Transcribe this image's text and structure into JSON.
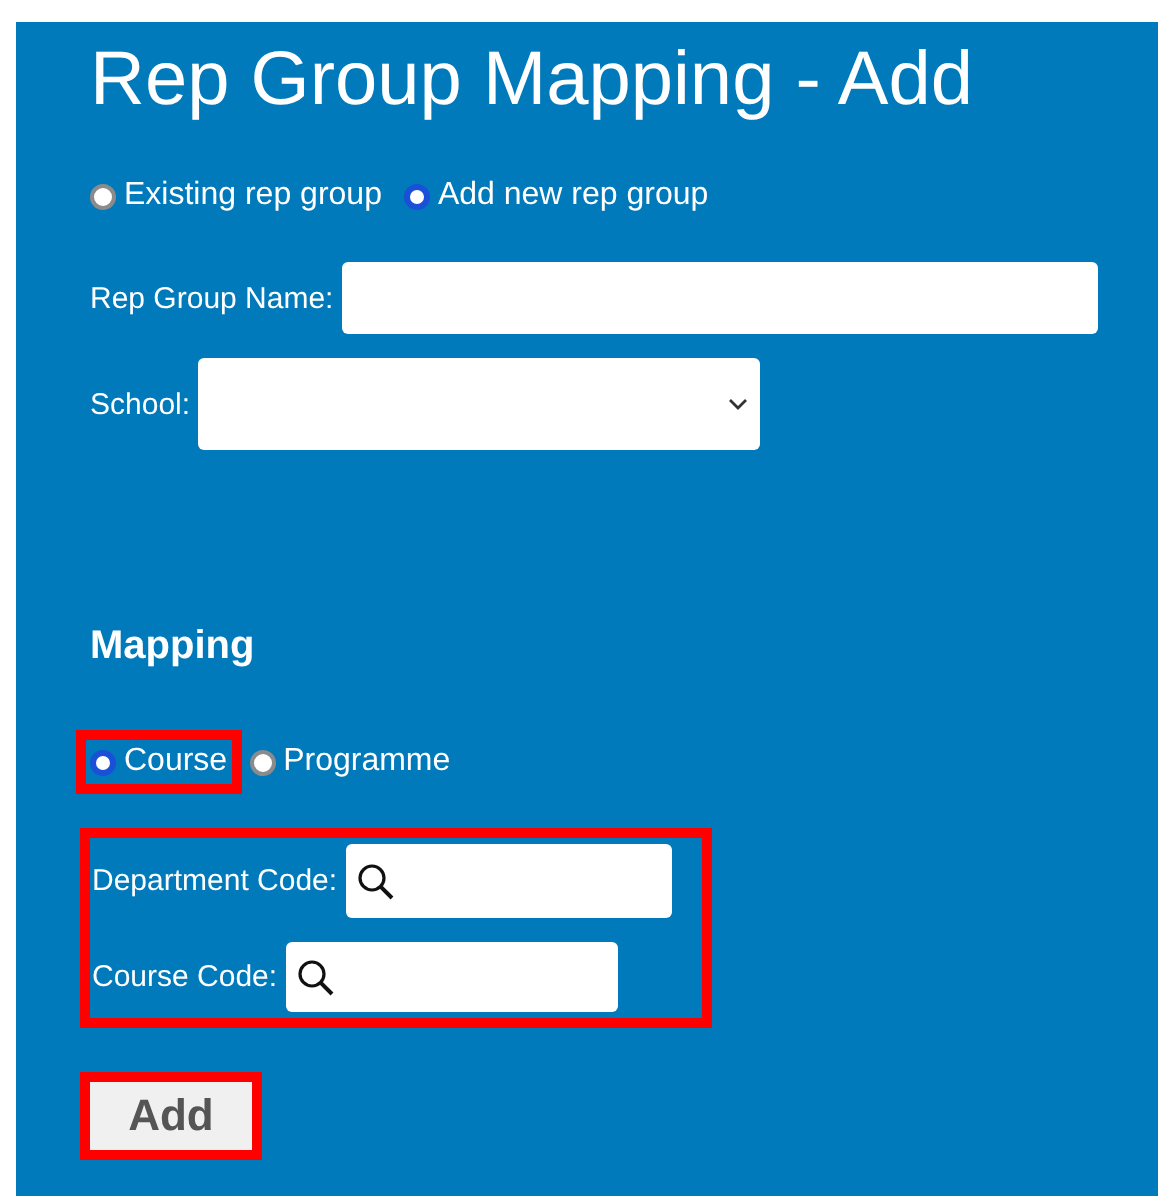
{
  "title": "Rep Group Mapping - Add",
  "group_mode": [
    {
      "label": "Existing rep group",
      "selected": false
    },
    {
      "label": "Add new rep group",
      "selected": true
    }
  ],
  "rep_group_name": {
    "label": "Rep Group Name:"
  },
  "school": {
    "label": "School:"
  },
  "mapping": {
    "heading": "Mapping",
    "mode": [
      {
        "label": "Course",
        "selected": true,
        "highlighted": true
      },
      {
        "label": "Programme",
        "selected": false,
        "highlighted": false
      }
    ],
    "codes_highlighted": true,
    "codes": [
      {
        "label": "Department Code:"
      },
      {
        "label": "Course Code:"
      }
    ]
  },
  "add_button": {
    "label": "Add",
    "highlighted": true
  }
}
